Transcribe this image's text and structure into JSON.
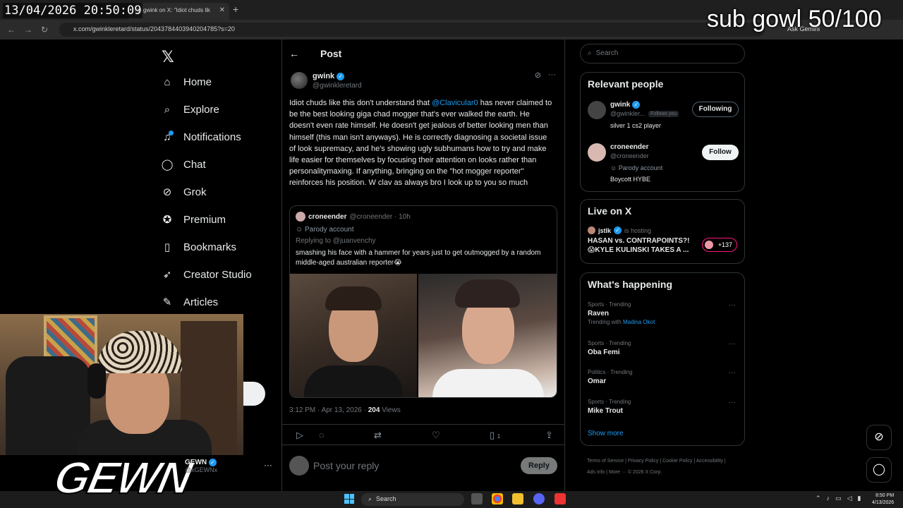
{
  "overlay": {
    "timestamp": "13/04/2026 20:50:09",
    "subgoal": "sub gowl 50/100",
    "logo_text": "GEWN"
  },
  "browser": {
    "tab_title": "(1) gwink on X: \"Idiot chuds lik",
    "url": "x.com/gwinkleretard/status/2043784403940204785?s=20",
    "ask_gemini": "Ask Gemini"
  },
  "nav": {
    "items": [
      {
        "label": "Home",
        "icon": "home-icon"
      },
      {
        "label": "Explore",
        "icon": "search-icon"
      },
      {
        "label": "Notifications",
        "icon": "bell-icon"
      },
      {
        "label": "Chat",
        "icon": "chat-icon"
      },
      {
        "label": "Grok",
        "icon": "grok-icon"
      },
      {
        "label": "Premium",
        "icon": "premium-icon"
      },
      {
        "label": "Bookmarks",
        "icon": "bookmark-icon"
      },
      {
        "label": "Creator Studio",
        "icon": "rocket-icon"
      },
      {
        "label": "Articles",
        "icon": "articles-icon"
      }
    ],
    "account_name": "GEWN",
    "account_handle": "@xGEWNx"
  },
  "post": {
    "header_title": "Post",
    "author_name": "gwink",
    "author_handle": "@gwinkleretard",
    "text_before_mention": "Idiot chuds like this don't understand that ",
    "mention": "@Clavicular0",
    "text_after_mention": " has never claimed to be the best looking giga chad mogger that's ever walked the earth. He doesn't even rate himself. He doesn't get jealous of better looking men than himself (this man isn't anyways). He is correctly diagnosing a societal issue of look supremacy, and he's showing ugly subhumans how to try and make life easier for themselves by focusing their attention on looks rather than personalitymaxing. If anything, bringing on the \"hot mogger reporter\" reinforces his position. W clav as always bro I look up to you so much",
    "time": "3:12 PM · Apr 13, 2026 · ",
    "views": "204",
    "views_label": " Views",
    "bookmark_count": "1",
    "reply_placeholder": "Post your reply",
    "reply_button": "Reply"
  },
  "quote": {
    "name": "croneender",
    "handle": "@croneender · 10h",
    "parody": "Parody account",
    "replying_to": "Replying to @juanvenchy",
    "text": "smashing his face with a hammer for years just to get outmogged by a random middle-aged australian reporter😭"
  },
  "sidebar": {
    "search_placeholder": "Search",
    "relevant_title": "Relevant people",
    "people": [
      {
        "name": "gwink",
        "handle": "@gwinkler...",
        "follows_you": "Follows you",
        "bio": "silver 1 cs2 player",
        "button": "Following"
      },
      {
        "name": "croneender",
        "handle": "@croneender",
        "parody": "Parody account",
        "bio": "Boycott HYBE",
        "button": "Follow"
      }
    ],
    "live_title": "Live on X",
    "live_host": "jstlk",
    "live_host_suffix": "is hosting",
    "live_stream_title": "HASAN vs. CONTRAPOINTS?! 😱KYLE KULINSKI TAKES A ...",
    "live_count": "+137",
    "happening_title": "What's happening",
    "trends": [
      {
        "category": "Sports · Trending",
        "name": "Raven",
        "with_label": "Trending with ",
        "with_name": "Madina Okot"
      },
      {
        "category": "Sports · Trending",
        "name": "Oba Femi"
      },
      {
        "category": "Politics · Trending",
        "name": "Omar"
      },
      {
        "category": "Sports · Trending",
        "name": "Mike Trout"
      }
    ],
    "show_more": "Show more",
    "footer": "Terms of Service  |  Privacy Policy  |  Cookie Policy  |  Accessibility  |  Ads info  |  More ···  © 2026 X Corp."
  },
  "taskbar": {
    "search": "Search",
    "time": "8:50 PM",
    "date": "4/13/2026"
  }
}
